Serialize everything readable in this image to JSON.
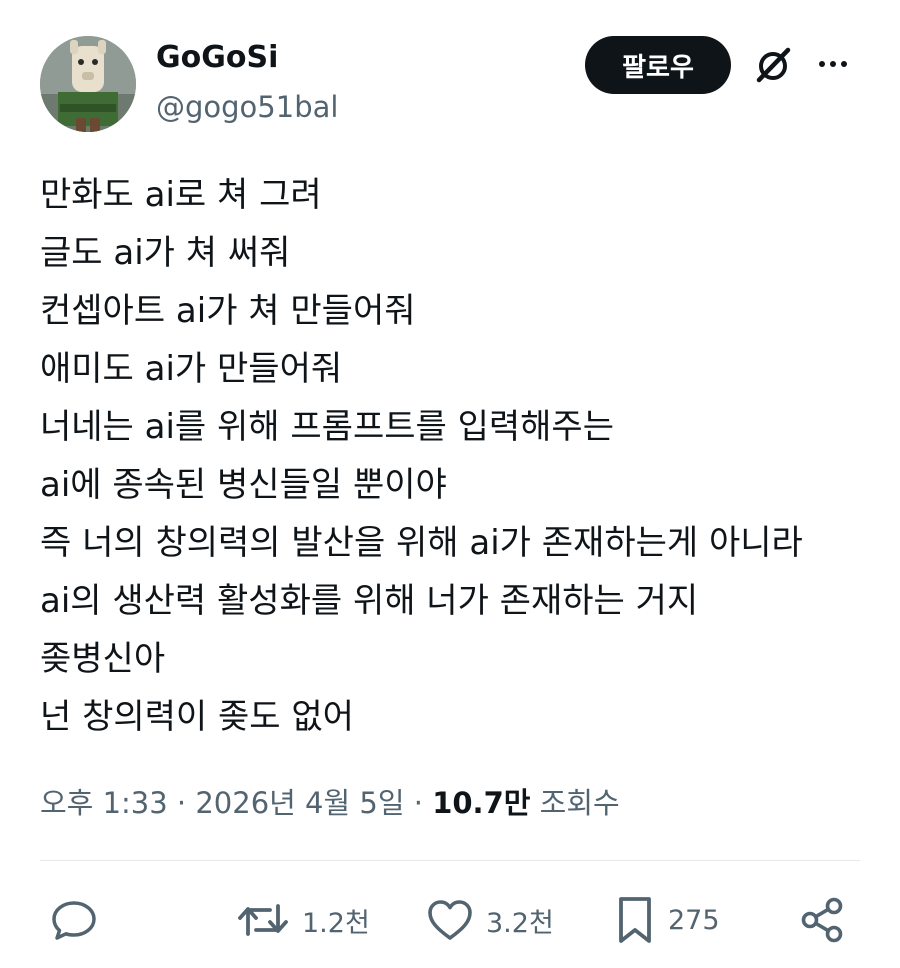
{
  "user": {
    "display_name": "GoGoSi",
    "handle": "@gogo51bal",
    "avatar_icon": "llama-avatar"
  },
  "header": {
    "follow_label": "팔로우",
    "grok_icon": "grok-icon",
    "more_icon": "more-icon"
  },
  "tweet": {
    "lines": [
      "만화도 ai로 쳐 그려",
      "글도 ai가 쳐 써줘",
      "컨셉아트 ai가 쳐 만들어줘",
      "애미도 ai가 만들어줘",
      "너네는 ai를 위해 프롬프트를 입력해주는",
      "ai에 종속된 병신들일 뿐이야",
      "즉 너의 창의력의 발산을 위해 ai가 존재하는게 아니라",
      "ai의 생산력 활성화를 위해 너가 존재하는 거지",
      "좆병신아",
      "넌 창의력이 좆도 없어"
    ]
  },
  "meta": {
    "time_date": "오후 1:33 · 2026년 4월 5일 · ",
    "views_count": "10.7만",
    "views_label": " 조회수"
  },
  "actions": {
    "reply_icon": "reply-icon",
    "retweet_count": "1.2천",
    "like_count": "3.2천",
    "bookmark_count": "275",
    "share_icon": "share-icon"
  },
  "colors": {
    "text_primary": "#0f1419",
    "text_secondary": "#536471",
    "follow_bg": "#0f1419",
    "divider": "#e6e9ea"
  }
}
